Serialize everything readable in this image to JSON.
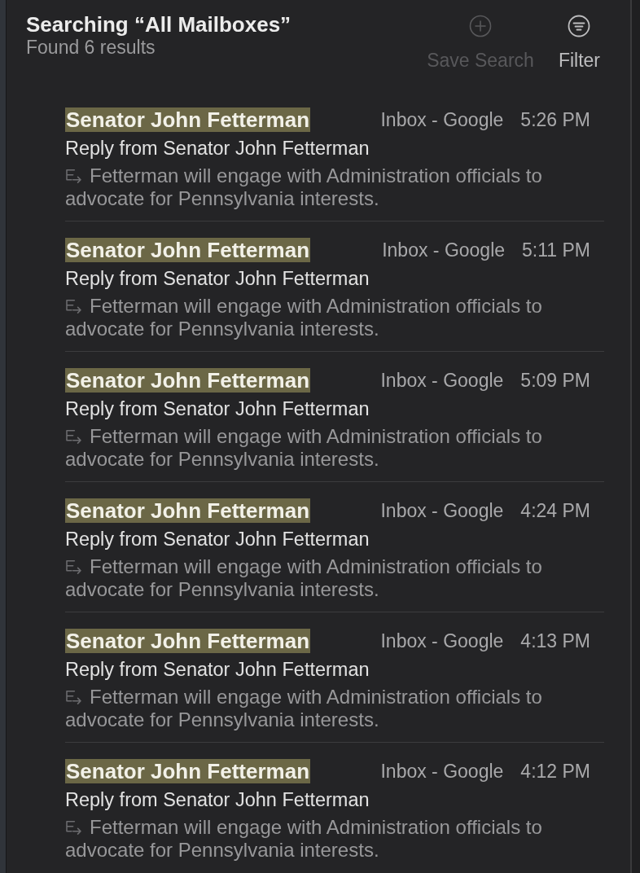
{
  "header": {
    "title": "Searching “All Mailboxes”",
    "subtitle": "Found 6 results"
  },
  "toolbar": [
    {
      "kind": "save",
      "label": "Save Search",
      "disabled": true
    },
    {
      "kind": "filter",
      "label": "Filter",
      "disabled": false
    }
  ],
  "results": [
    {
      "sender": "Senator John Fetterman",
      "highlighted": true,
      "mailbox": "Inbox - Google",
      "time": "5:26 PM",
      "subject": "Reply from Senator John Fetterman",
      "replied": true,
      "preview": "Fetterman will engage with Administration officials to advocate for Pennsylvania interests."
    },
    {
      "sender": "Senator John Fetterman",
      "highlighted": true,
      "mailbox": "Inbox - Google",
      "time": "5:11 PM",
      "subject": "Reply from Senator John Fetterman",
      "replied": true,
      "preview": "Fetterman will engage with Administration officials to advocate for Pennsylvania interests."
    },
    {
      "sender": "Senator John Fetterman",
      "highlighted": true,
      "mailbox": "Inbox - Google",
      "time": "5:09 PM",
      "subject": "Reply from Senator John Fetterman",
      "replied": true,
      "preview": "Fetterman will engage with Administration officials to advocate for Pennsylvania interests."
    },
    {
      "sender": "Senator John Fetterman",
      "highlighted": true,
      "mailbox": "Inbox - Google",
      "time": "4:24 PM",
      "subject": "Reply from Senator John Fetterman",
      "replied": true,
      "preview": "Fetterman will engage with Administration officials to advocate for Pennsylvania interests."
    },
    {
      "sender": "Senator John Fetterman",
      "highlighted": true,
      "mailbox": "Inbox - Google",
      "time": "4:13 PM",
      "subject": "Reply from Senator John Fetterman",
      "replied": true,
      "preview": "Fetterman will engage with Administration officials to advocate for Pennsylvania interests."
    },
    {
      "sender": "Senator John Fetterman",
      "highlighted": true,
      "mailbox": "Inbox - Google",
      "time": "4:12 PM",
      "subject": "Reply from Senator John Fetterman",
      "replied": true,
      "preview": "Fetterman will engage with Administration officials to advocate for Pennsylvania interests."
    }
  ]
}
